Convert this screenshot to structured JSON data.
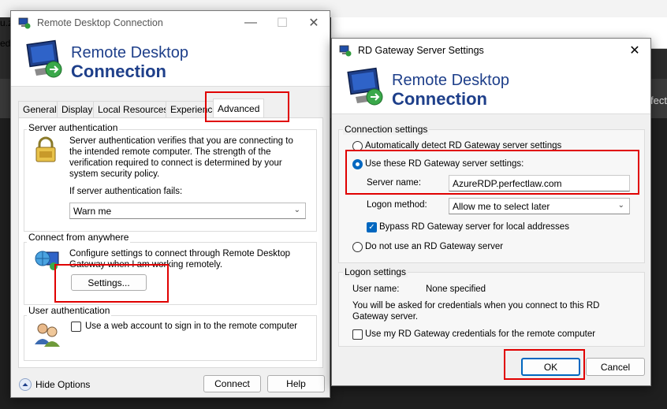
{
  "background": {
    "left_text_1": "u.zi",
    "left_text_2": "ed",
    "right_text": "rfect"
  },
  "rdc": {
    "title": "Remote Desktop Connection",
    "banner_line1": "Remote Desktop",
    "banner_line2": "Connection",
    "tabs": [
      "General",
      "Display",
      "Local Resources",
      "Experience",
      "Advanced"
    ],
    "server_auth": {
      "title": "Server authentication",
      "description": "Server authentication verifies that you are connecting to the intended remote computer. The strength of the verification required to connect is determined by your system security policy.",
      "fail_label": "If server authentication fails:",
      "fail_value": "Warn me"
    },
    "connect_anywhere": {
      "title": "Connect from anywhere",
      "description": "Configure settings to connect through Remote Desktop Gateway when I am working remotely.",
      "settings_button": "Settings..."
    },
    "user_auth": {
      "title": "User authentication",
      "web_account_label": "Use a web account to sign in to the remote computer"
    },
    "hide_options": "Hide Options",
    "connect_button": "Connect",
    "help_button": "Help"
  },
  "gateway": {
    "title": "RD Gateway Server Settings",
    "banner_line1": "Remote Desktop",
    "banner_line2": "Connection",
    "connection_settings": {
      "title": "Connection settings",
      "auto_detect": "Automatically detect RD Gateway server settings",
      "use_these": "Use these RD Gateway server settings:",
      "server_name_label": "Server name:",
      "server_name_value": "AzureRDP.perfectlaw.com",
      "logon_method_label": "Logon method:",
      "logon_method_value": "Allow me to select later",
      "bypass_label": "Bypass RD Gateway server for local addresses",
      "do_not_use": "Do not use an RD Gateway server"
    },
    "logon_settings": {
      "title": "Logon settings",
      "user_name_label": "User name:",
      "user_name_value": "None specified",
      "credentials_note": "You will be asked for credentials when you connect to this RD Gateway server.",
      "use_credentials_label": "Use my RD Gateway credentials for the remote computer"
    },
    "ok_button": "OK",
    "cancel_button": "Cancel"
  },
  "colors": {
    "accent": "#0067c0",
    "brand_text": "#1e3f8a",
    "highlight": "#e00000"
  }
}
